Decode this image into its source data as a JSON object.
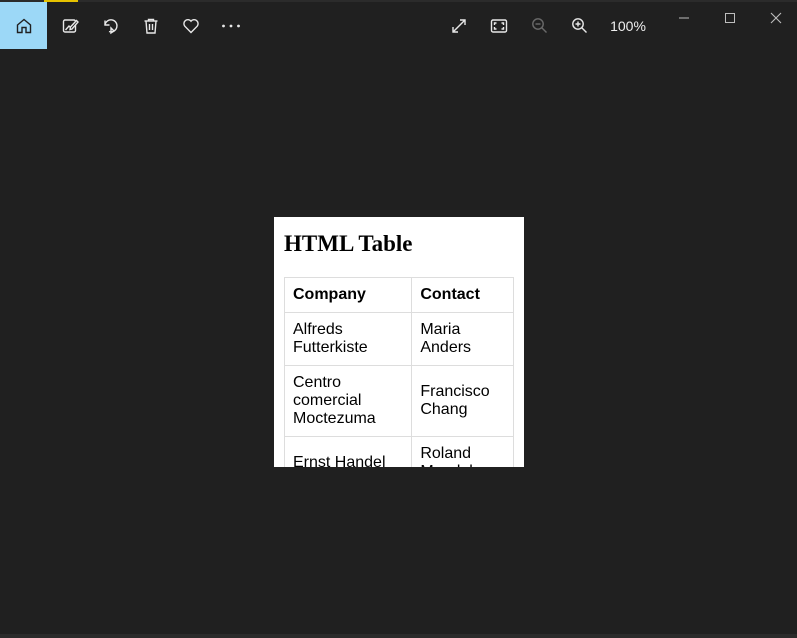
{
  "toolbar": {
    "buttons": [
      {
        "name": "home",
        "icon": "home-icon"
      },
      {
        "name": "edit",
        "icon": "edit-image-icon"
      },
      {
        "name": "rotate",
        "icon": "rotate-icon"
      },
      {
        "name": "delete",
        "icon": "trash-icon"
      },
      {
        "name": "favorite",
        "icon": "heart-icon"
      },
      {
        "name": "more",
        "icon": "more-icon"
      }
    ],
    "view_buttons": [
      {
        "name": "fullscreen",
        "icon": "expand-icon"
      },
      {
        "name": "fit",
        "icon": "fit-to-window-icon"
      },
      {
        "name": "zoom-out",
        "icon": "zoom-out-icon",
        "disabled": true
      },
      {
        "name": "zoom-in",
        "icon": "zoom-in-icon"
      }
    ],
    "zoom_level": "100%",
    "accent_color": "#9cd8f7"
  },
  "window_controls": [
    "minimize-icon",
    "maximize-icon",
    "close-icon"
  ],
  "image": {
    "heading": "HTML Table",
    "table": {
      "headers": [
        "Company",
        "Contact"
      ],
      "rows": [
        [
          "Alfreds Futterkiste",
          "Maria Anders"
        ],
        [
          "Centro comercial Moctezuma",
          "Francisco Chang"
        ],
        [
          "Ernst Handel",
          "Roland Mendel"
        ]
      ]
    }
  }
}
